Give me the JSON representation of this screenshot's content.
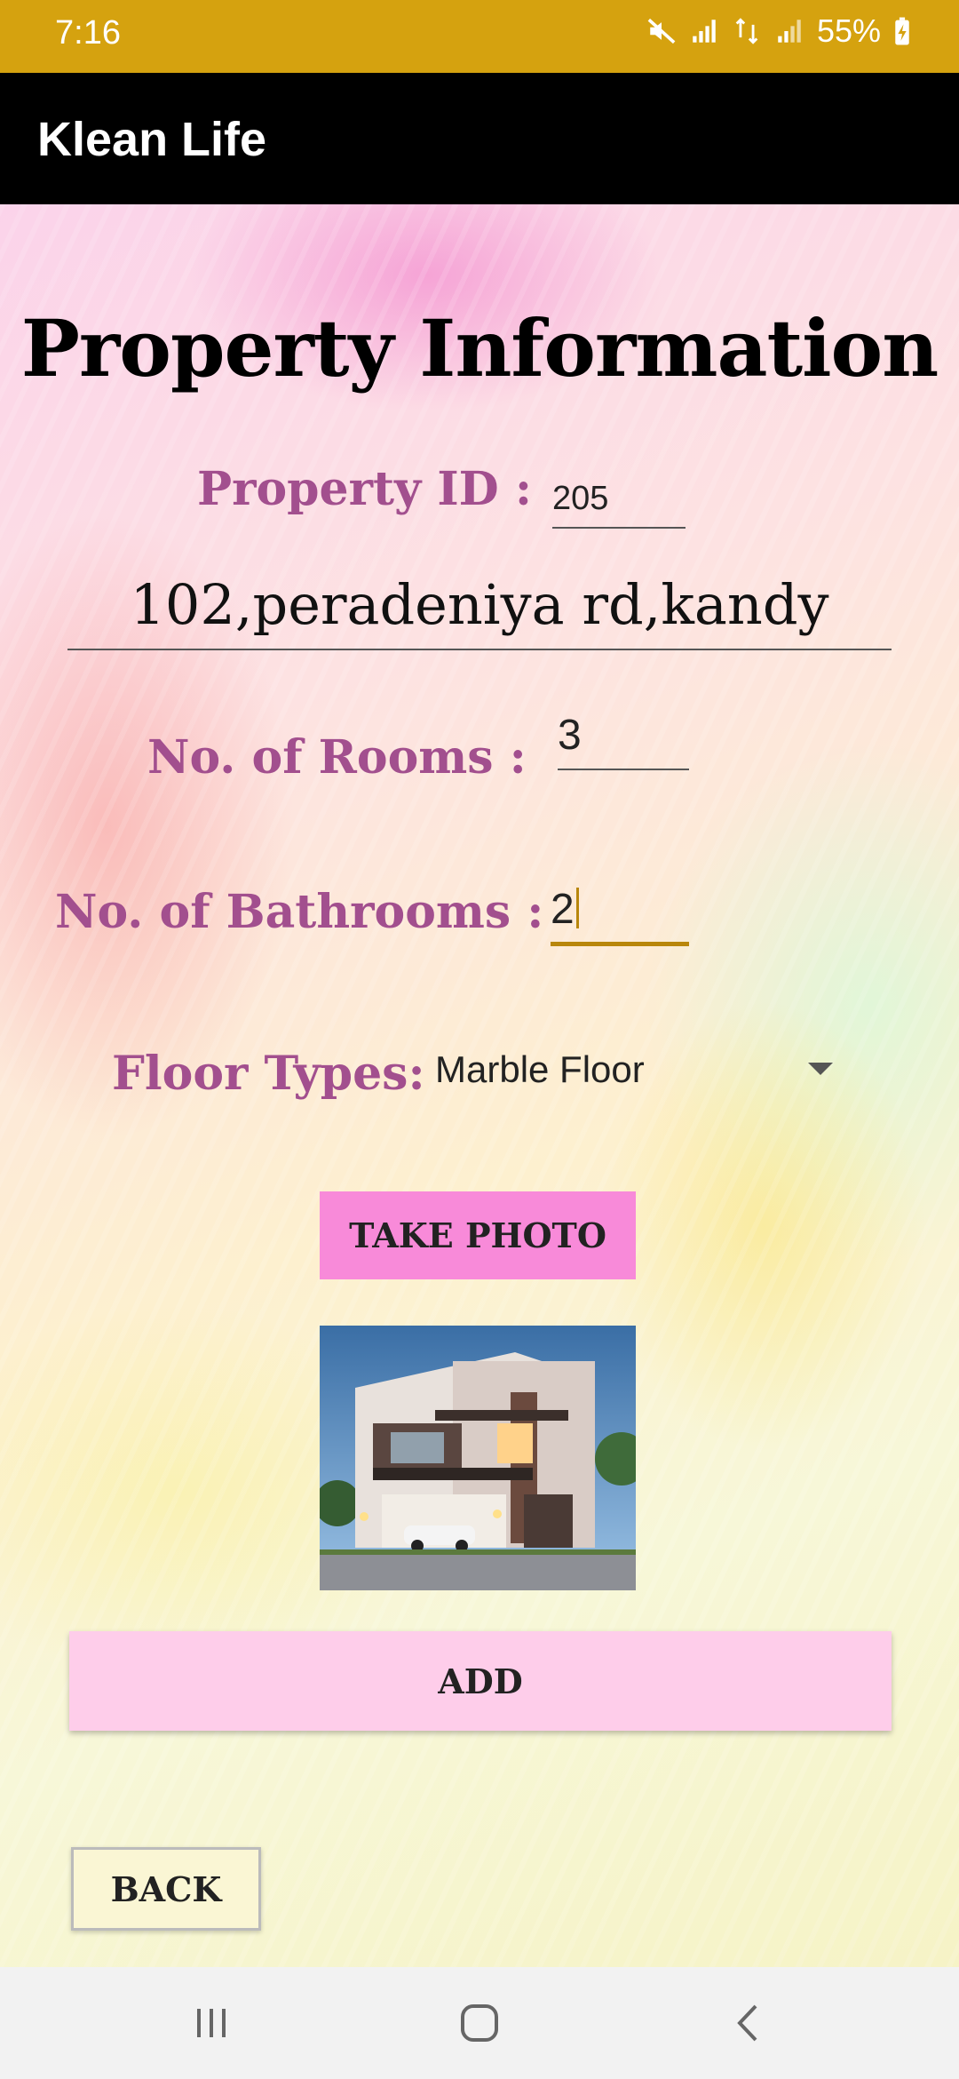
{
  "status_bar": {
    "time": "7:16",
    "battery": "55%",
    "icons": [
      "mute-icon",
      "signal-icon",
      "data-icon",
      "signal-icon",
      "battery-charging-icon"
    ]
  },
  "app_bar": {
    "title": "Klean Life"
  },
  "form": {
    "title": "Property Information",
    "property_id": {
      "label": "Property ID :",
      "value": "205"
    },
    "address": {
      "value": "102,peradeniya rd,kandy"
    },
    "rooms": {
      "label": "No. of Rooms :",
      "value": "3"
    },
    "bathrooms": {
      "label": "No. of Bathrooms :",
      "value": "2"
    },
    "floor_types": {
      "label": "Floor Types:",
      "selected": "Marble Floor"
    },
    "take_photo_label": "TAKE PHOTO",
    "add_label": "ADD",
    "back_label": "BACK"
  },
  "nav_bar": {
    "buttons": [
      "recents-icon",
      "home-icon",
      "back-icon"
    ]
  },
  "colors": {
    "status_bar": "#d5a20f",
    "app_bar": "#000000",
    "label": "#a24f8e",
    "take_photo_button": "#f88ad9",
    "add_button": "#fecdea",
    "back_button": "#faf6d4",
    "active_underline": "#b8860b"
  }
}
